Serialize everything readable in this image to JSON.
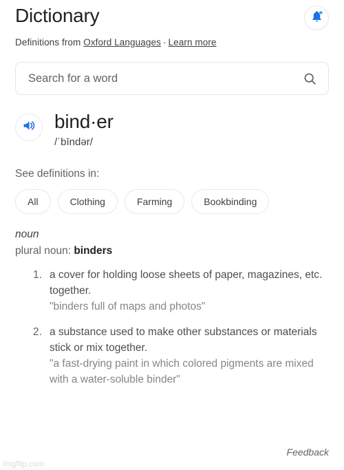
{
  "header": {
    "title": "Dictionary",
    "bell_icon": "notification-add-icon",
    "subtitle_prefix": "Definitions from ",
    "source_link": "Oxford Languages",
    "separator": "·",
    "learn_more_link": "Learn more"
  },
  "search": {
    "placeholder": "Search for a word",
    "value": "",
    "icon": "search-icon"
  },
  "entry": {
    "speaker_icon": "volume-up-icon",
    "headword": "bind·er",
    "phonetic": "/ˈbīndər/"
  },
  "definitions_in": {
    "label": "See definitions in:",
    "chips": [
      {
        "label": "All",
        "selected": false
      },
      {
        "label": "Clothing",
        "selected": false
      },
      {
        "label": "Farming",
        "selected": false
      },
      {
        "label": "Bookbinding",
        "selected": false
      }
    ]
  },
  "sense": {
    "part_of_speech": "noun",
    "plural_label": "plural noun: ",
    "plural_form": "binders",
    "definitions": [
      {
        "text": "a cover for holding loose sheets of paper, magazines, etc. together.",
        "example": "\"binders full of maps and photos\""
      },
      {
        "text": "a substance used to make other substances or materials stick or mix together.",
        "example": "\"a fast-drying paint in which colored pigments are mixed with a water-soluble binder\""
      }
    ]
  },
  "footer": {
    "feedback_label": "Feedback",
    "watermark": "imgflip.com"
  },
  "colors": {
    "accent_blue": "#1a73e8",
    "text_primary": "#202124",
    "text_secondary": "#5f6368",
    "border": "#e3e5e8"
  }
}
